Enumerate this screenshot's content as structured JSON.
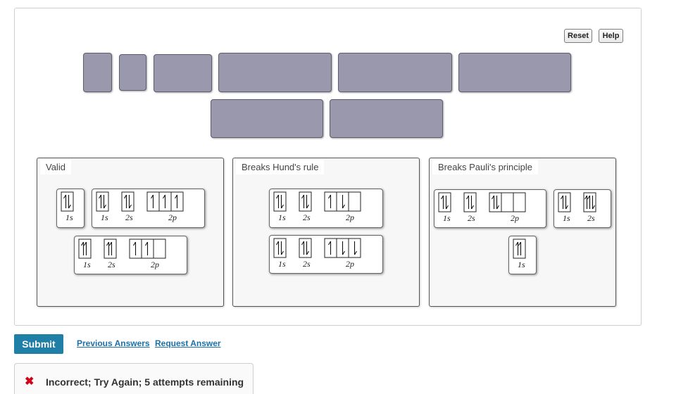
{
  "toolbar": {
    "reset_label": "Reset",
    "help_label": "Help"
  },
  "answer_slots": {
    "count": 8
  },
  "bins": [
    {
      "label": "Valid"
    },
    {
      "label": "Breaks Hund's rule"
    },
    {
      "label": "Breaks Pauli's principle"
    }
  ],
  "orbital_labels": {
    "s1": "1s",
    "s2": "2s",
    "p2": "2p"
  },
  "cards": [
    {
      "bin": "Valid",
      "boxes": [
        [
          "ud"
        ]
      ]
    },
    {
      "bin": "Valid",
      "boxes": [
        [
          "ud"
        ],
        [
          "ud"
        ],
        [
          "u",
          "u",
          "u"
        ]
      ]
    },
    {
      "bin": "Valid",
      "boxes": [
        [
          "uu"
        ],
        [
          "uu"
        ],
        [
          "u",
          "u",
          ""
        ]
      ]
    },
    {
      "bin": "Breaks Hund's rule",
      "boxes": [
        [
          "ud"
        ],
        [
          "ud"
        ],
        [
          "u",
          "d",
          ""
        ]
      ]
    },
    {
      "bin": "Breaks Hund's rule",
      "boxes": [
        [
          "ud"
        ],
        [
          "ud"
        ],
        [
          "u",
          "d",
          "d"
        ]
      ]
    },
    {
      "bin": "Breaks Pauli's principle",
      "boxes": [
        [
          "ud"
        ],
        [
          "ud"
        ],
        [
          "ud",
          "",
          ""
        ]
      ]
    },
    {
      "bin": "Breaks Pauli's principle",
      "boxes": [
        [
          "ud"
        ],
        [
          "uud"
        ]
      ]
    },
    {
      "bin": "Breaks Pauli's principle",
      "boxes": [
        [
          "uu"
        ]
      ]
    }
  ],
  "actions": {
    "submit_label": "Submit",
    "previous_answers_label": "Previous Answers",
    "request_answer_label": "Request Answer"
  },
  "feedback": {
    "message": "Incorrect; Try Again; 5 attempts remaining",
    "status_color": "#d0021b"
  },
  "colors": {
    "slot": "#9a98ad",
    "submit": "#1f7fa6",
    "link": "#1d6fa5"
  }
}
